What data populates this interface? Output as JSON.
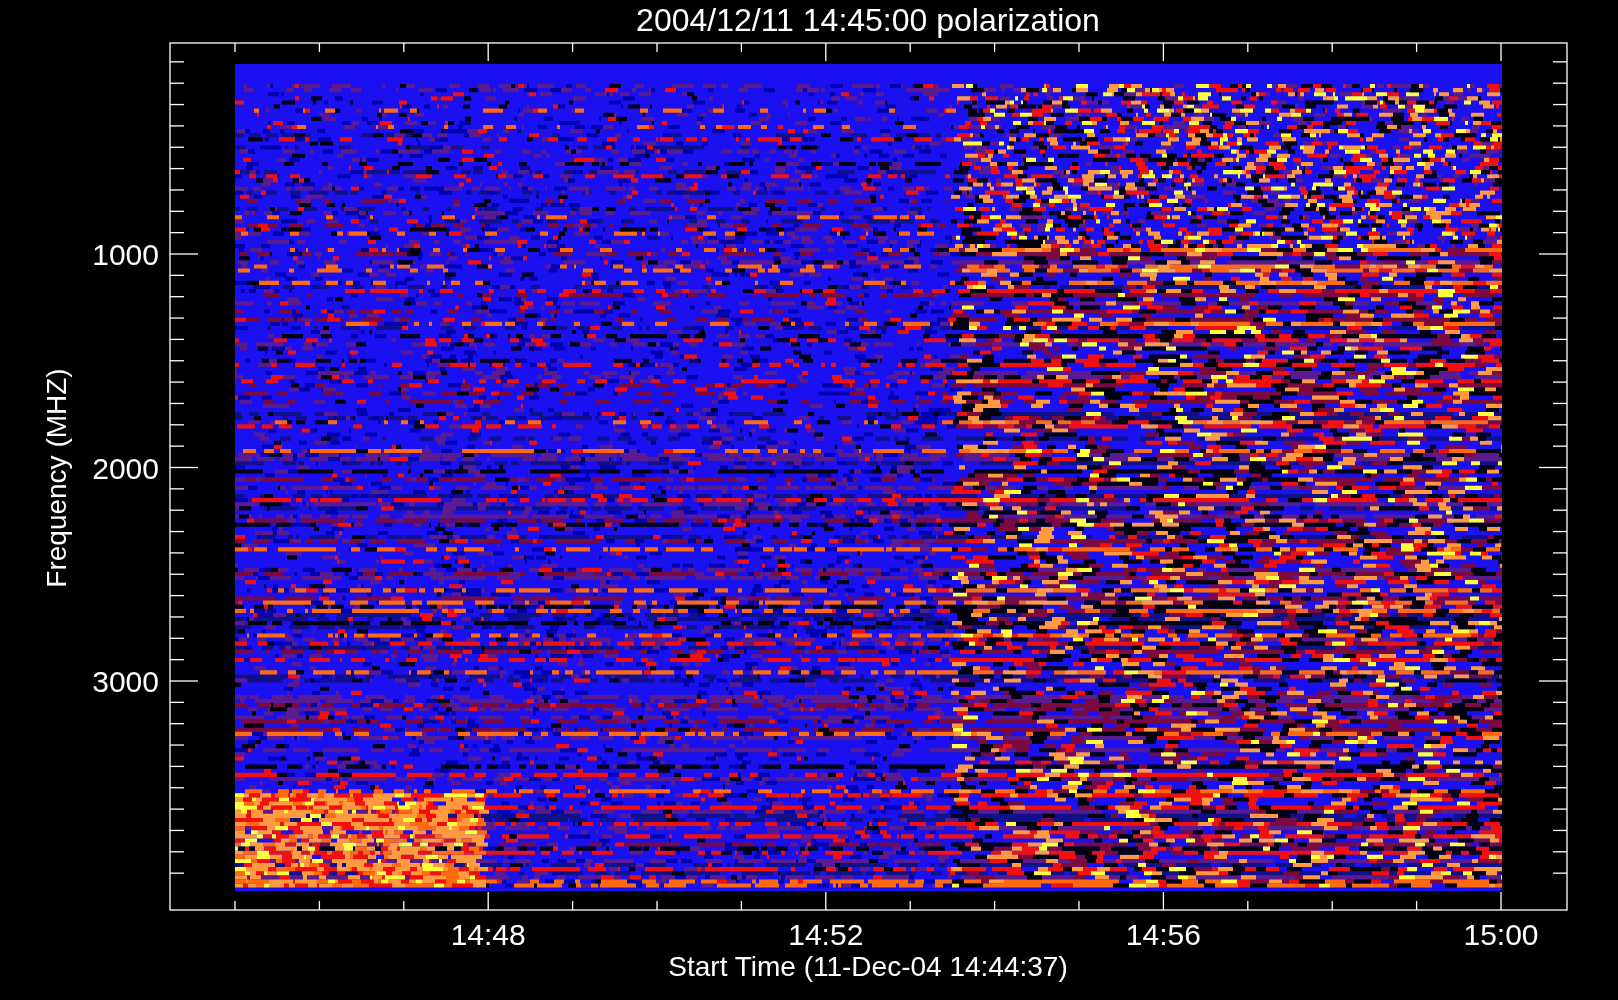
{
  "title": "2004/12/11 14:45:00 polarization",
  "y_axis": {
    "label": "Frequency (MHZ)",
    "tick_labels": [
      "1000",
      "2000",
      "3000"
    ]
  },
  "x_axis": {
    "label": "Start Time (11-Dec-04 14:44:37)",
    "tick_labels": [
      "14:48",
      "14:52",
      "14:56",
      "15:00"
    ]
  }
}
